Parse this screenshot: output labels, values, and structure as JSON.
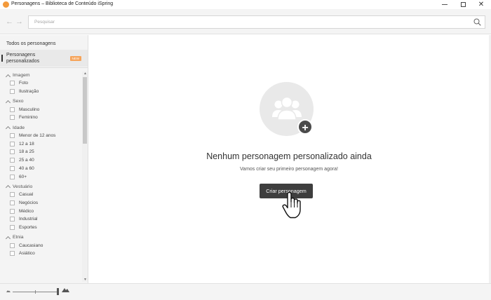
{
  "window": {
    "title": "Personagens – Biblioteca de Conteúdo iSpring",
    "close_glyph": "✕"
  },
  "toolbar": {
    "back_glyph": "←",
    "forward_glyph": "→",
    "search_placeholder": "Pesquisar",
    "search_value": ""
  },
  "sidebar": {
    "nav": [
      {
        "label": "Todos os personagens"
      },
      {
        "label": "Personagens personalizados",
        "badge": "NEW",
        "active": true
      }
    ],
    "filter_groups": [
      {
        "title": "Imagem",
        "options": [
          "Foto",
          "Ilustração"
        ]
      },
      {
        "title": "Sexo",
        "options": [
          "Masculino",
          "Feminino"
        ]
      },
      {
        "title": "Idade",
        "options": [
          "Menor de 12 anos",
          "12 a 18",
          "18 a 25",
          "25 a 40",
          "40 a 60",
          "60+"
        ]
      },
      {
        "title": "Vestuário",
        "options": [
          "Casual",
          "Negócios",
          "Médico",
          "Industrial",
          "Esportes"
        ]
      },
      {
        "title": "Etnia",
        "options": [
          "Caucasiano",
          "Asiático"
        ]
      }
    ]
  },
  "main": {
    "empty_title": "Nenhum personagem personalizado ainda",
    "empty_subtitle": "Vamos criar seu primeiro personagem agora!",
    "create_button": "Criar personagem",
    "plus_glyph": "+"
  },
  "icons": [
    "app-icon",
    "back-arrow-icon",
    "forward-arrow-icon",
    "search-icon",
    "people-icon",
    "plus-icon",
    "hand-cursor-icon",
    "zoom-small-icon",
    "zoom-large-icon"
  ]
}
